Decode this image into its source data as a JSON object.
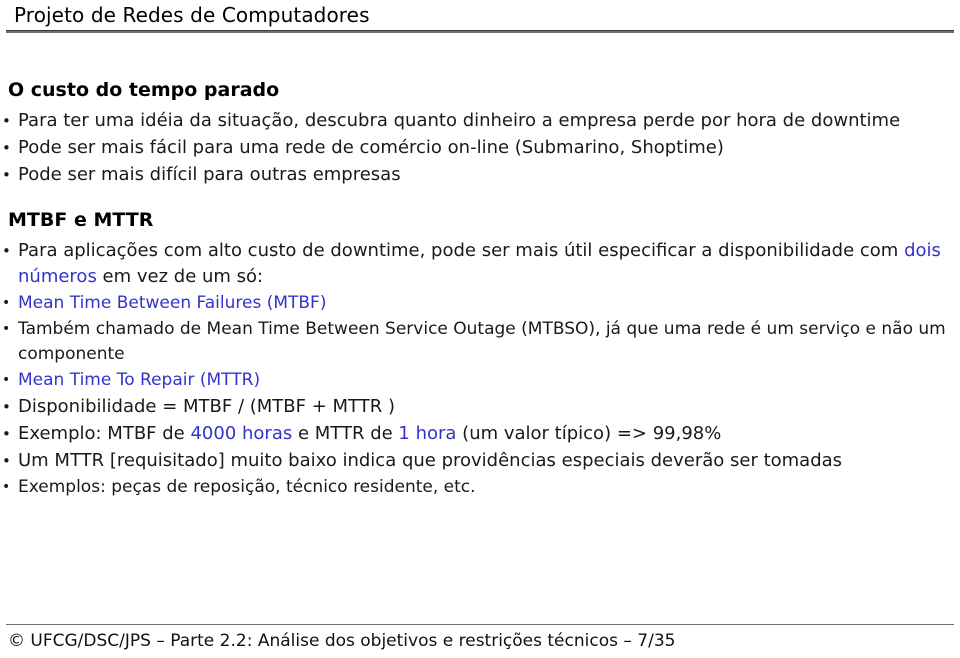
{
  "header": {
    "title": "Projeto de Redes de Computadores"
  },
  "colors": {
    "accent_blue": "#3333CC",
    "text": "#000000",
    "rule": "#6E6E6E",
    "background": "#FFFFFF"
  },
  "sections": [
    {
      "heading": "O custo do tempo parado",
      "bullets": [
        {
          "level": 1,
          "runs": [
            {
              "text": "Para ter uma idéia da situação, descubra quanto dinheiro a empresa perde por hora de downtime",
              "color": "text"
            }
          ]
        },
        {
          "level": 1,
          "runs": [
            {
              "text": "Pode ser mais fácil para uma rede de comércio on-line (Submarino, Shoptime)",
              "color": "text"
            }
          ]
        },
        {
          "level": 1,
          "runs": [
            {
              "text": "Pode ser mais difícil para outras empresas",
              "color": "text"
            }
          ]
        }
      ]
    },
    {
      "heading": "MTBF e MTTR",
      "bullets": [
        {
          "level": 1,
          "runs": [
            {
              "text": "Para aplicações com alto custo de downtime, pode ser mais útil especificar a disponibilidade com ",
              "color": "text"
            },
            {
              "text": "dois números",
              "color": "accent_blue"
            },
            {
              "text": " em vez de um só:",
              "color": "text"
            }
          ]
        },
        {
          "level": 2,
          "runs": [
            {
              "text": "Mean Time Between Failures (MTBF)",
              "color": "accent_blue"
            }
          ]
        },
        {
          "level": 3,
          "runs": [
            {
              "text": "Também chamado de Mean Time Between Service Outage (MTBSO), já que uma rede é um serviço e não um componente",
              "color": "text"
            }
          ]
        },
        {
          "level": 2,
          "runs": [
            {
              "text": "Mean Time To Repair (MTTR)",
              "color": "accent_blue"
            }
          ]
        },
        {
          "level": 1,
          "runs": [
            {
              "text": "Disponibilidade = MTBF / (MTBF + MTTR )",
              "color": "text"
            }
          ]
        },
        {
          "level": 1,
          "runs": [
            {
              "text": "Exemplo: MTBF de ",
              "color": "text"
            },
            {
              "text": "4000 horas",
              "color": "accent_blue"
            },
            {
              "text": " e MTTR de ",
              "color": "text"
            },
            {
              "text": "1 hora",
              "color": "accent_blue"
            },
            {
              "text": " (um valor típico) => 99,98%",
              "color": "text"
            }
          ]
        },
        {
          "level": 1,
          "runs": [
            {
              "text": "Um MTTR [requisitado] muito baixo indica que providências especiais deverão ser tomadas",
              "color": "text"
            }
          ]
        },
        {
          "level": 2,
          "runs": [
            {
              "text": "Exemplos: peças de reposição, técnico residente, etc.",
              "color": "text"
            }
          ]
        }
      ]
    }
  ],
  "footer": {
    "text": "© UFCG/DSC/JPS – Parte 2.2: Análise dos objetivos e restrições técnicos – 7/35",
    "copyright_symbol": "©",
    "course": "UFCG/DSC/JPS",
    "part": "Parte 2.2: Análise dos objetivos e restrições técnicos",
    "page": "7/35"
  }
}
